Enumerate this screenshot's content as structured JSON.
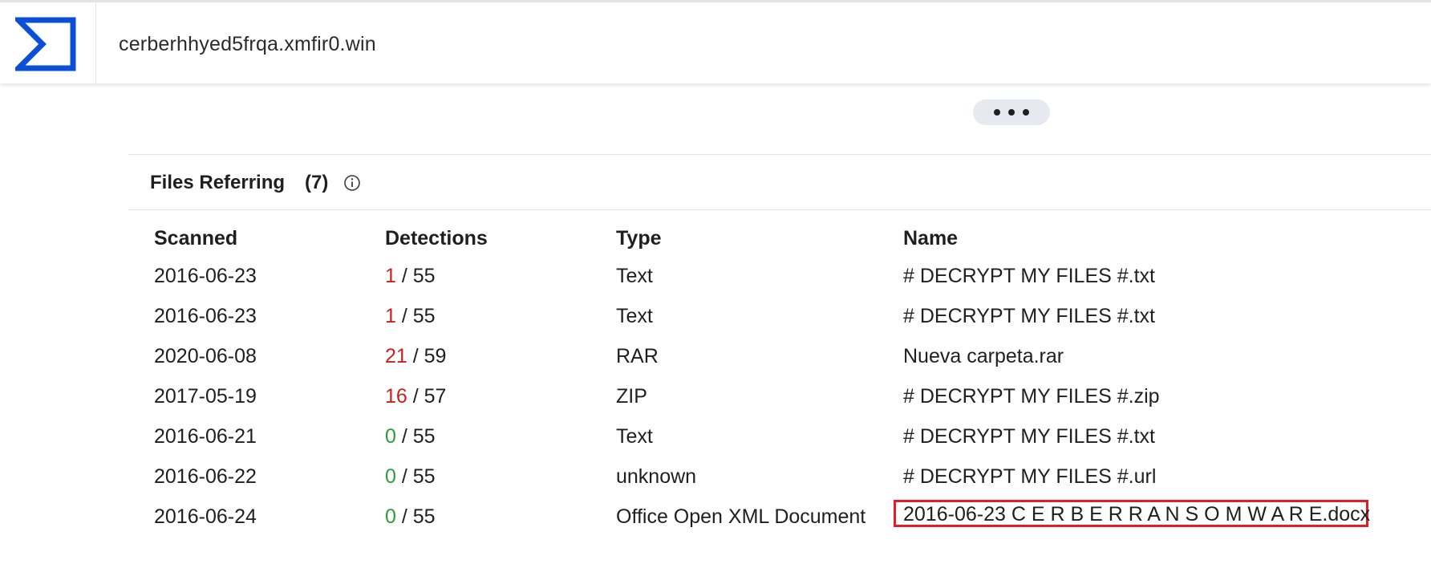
{
  "header": {
    "search_value": "cerberhhyed5frqa.xmfir0.win"
  },
  "files_referring": {
    "title": "Files Referring",
    "count": "(7)",
    "columns": [
      "Scanned",
      "Detections",
      "Type",
      "Name"
    ],
    "rows": [
      {
        "scanned": "2016-06-23",
        "detections": "1",
        "total": "55",
        "type": "Text",
        "name": "# DECRYPT MY FILES #.txt",
        "status": "positive"
      },
      {
        "scanned": "2016-06-23",
        "detections": "1",
        "total": "55",
        "type": "Text",
        "name": "# DECRYPT MY FILES #.txt",
        "status": "positive"
      },
      {
        "scanned": "2020-06-08",
        "detections": "21",
        "total": "59",
        "type": "RAR",
        "name": "Nueva carpeta.rar",
        "status": "positive"
      },
      {
        "scanned": "2017-05-19",
        "detections": "16",
        "total": "57",
        "type": "ZIP",
        "name": "# DECRYPT MY FILES #.zip",
        "status": "positive"
      },
      {
        "scanned": "2016-06-21",
        "detections": "0",
        "total": "55",
        "type": "Text",
        "name": "# DECRYPT MY FILES #.txt",
        "status": "clean"
      },
      {
        "scanned": "2016-06-22",
        "detections": "0",
        "total": "55",
        "type": "unknown",
        "name": "# DECRYPT MY FILES #.url",
        "status": "clean"
      },
      {
        "scanned": "2016-06-24",
        "detections": "0",
        "total": "55",
        "type": "Office Open XML Document",
        "name": "2016-06-23 C E R B E R R A N S O M W A R E.docx",
        "status": "clean",
        "highlighted": true
      }
    ]
  },
  "colors": {
    "brand": "#0b4fd8",
    "detection_positive": "#c5221f",
    "detection_clean": "#2e9e3a",
    "highlight_border": "#e11d2a"
  },
  "icons": {
    "logo": "virustotal-sigma-logo-icon",
    "info": "info-icon",
    "more": "more-horizontal-icon"
  }
}
